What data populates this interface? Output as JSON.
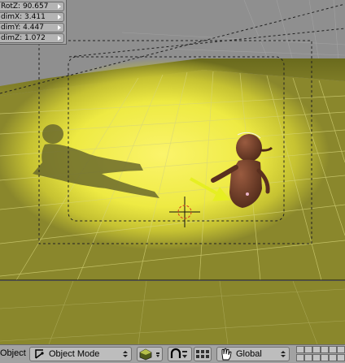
{
  "viewport": {
    "properties_panel": {
      "fields": [
        {
          "label": "RotZ: 90.657"
        },
        {
          "label": "dimX: 3.411"
        },
        {
          "label": "dimY: 4.447"
        },
        {
          "label": "dimZ: 1.072"
        }
      ]
    },
    "colors": {
      "floor": "#8c8b2c",
      "spotlight": "#f1ed4c",
      "character": "#6e3b27",
      "arrow": "#e6ef22",
      "background": "#8f8f8f"
    }
  },
  "header": {
    "mode_label": "Object",
    "mode_select": "Object Mode",
    "orientation_select": "Global",
    "icons": [
      "mode-icon",
      "shading-solid-icon",
      "pivot-icon",
      "proportional-icon",
      "snap-icon",
      "transform-hand-icon"
    ]
  }
}
